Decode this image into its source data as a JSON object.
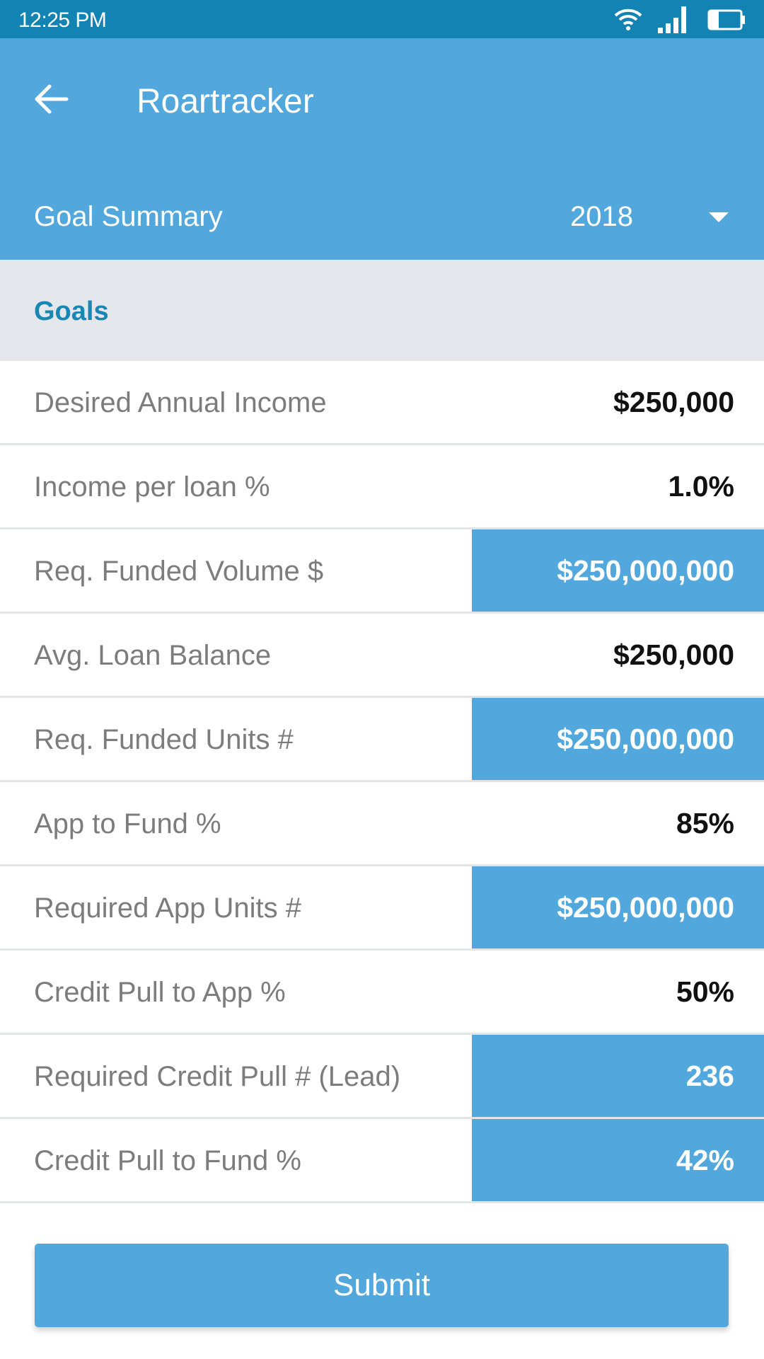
{
  "status_bar": {
    "time": "12:25 PM",
    "icons": [
      "wifi-icon",
      "signal-icon",
      "battery-icon"
    ]
  },
  "app_bar": {
    "back_icon": "arrow-left-icon",
    "title": "Roartracker"
  },
  "sub_bar": {
    "label": "Goal Summary",
    "year_selected": "2018",
    "dropdown_icon": "caret-down-icon"
  },
  "section": {
    "title": "Goals"
  },
  "rows": [
    {
      "label": "Desired Annual Income",
      "value": "$250,000",
      "highlight": false
    },
    {
      "label": "Income per loan %",
      "value": "1.0%",
      "highlight": false
    },
    {
      "label": "Req. Funded Volume $",
      "value": "$250,000,000",
      "highlight": true
    },
    {
      "label": "Avg. Loan Balance",
      "value": "$250,000",
      "highlight": false
    },
    {
      "label": "Req. Funded Units #",
      "value": "$250,000,000",
      "highlight": true
    },
    {
      "label": "App to Fund %",
      "value": "85%",
      "highlight": false
    },
    {
      "label": "Required App Units #",
      "value": "$250,000,000",
      "highlight": true
    },
    {
      "label": "Credit Pull to App %",
      "value": "50%",
      "highlight": false
    },
    {
      "label": "Required Credit Pull # (Lead)",
      "value": "236",
      "highlight": true
    },
    {
      "label": "Credit Pull to Fund %",
      "value": "42%",
      "highlight": true
    }
  ],
  "actions": {
    "submit_label": "Submit"
  },
  "colors": {
    "status_bar": "#1283b2",
    "primary": "#52a7dc",
    "section_bg": "#e4e7eb",
    "section_title": "#1a86b4",
    "label_text": "#7c7c7c"
  }
}
